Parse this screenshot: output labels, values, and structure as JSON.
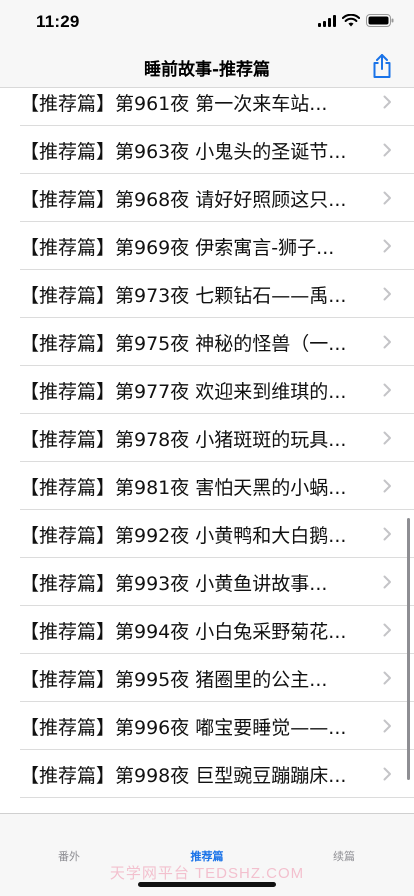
{
  "status_bar": {
    "time": "11:29"
  },
  "nav": {
    "title": "睡前故事-推荐篇"
  },
  "list": {
    "items": [
      {
        "label": "【推荐篇】第961夜 第一次来车站..."
      },
      {
        "label": "【推荐篇】第963夜 小鬼头的圣诞节..."
      },
      {
        "label": "【推荐篇】第968夜 请好好照顾这只..."
      },
      {
        "label": "【推荐篇】第969夜 伊索寓言-狮子..."
      },
      {
        "label": "【推荐篇】第973夜 七颗钻石——禹..."
      },
      {
        "label": "【推荐篇】第975夜 神秘的怪兽（一..."
      },
      {
        "label": "【推荐篇】第977夜 欢迎来到维琪的..."
      },
      {
        "label": "【推荐篇】第978夜 小猪斑斑的玩具..."
      },
      {
        "label": "【推荐篇】第981夜 害怕天黑的小蜗..."
      },
      {
        "label": "【推荐篇】第992夜 小黄鸭和大白鹅..."
      },
      {
        "label": "【推荐篇】第993夜 小黄鱼讲故事..."
      },
      {
        "label": "【推荐篇】第994夜 小白兔采野菊花..."
      },
      {
        "label": "【推荐篇】第995夜 猪圈里的公主..."
      },
      {
        "label": "【推荐篇】第996夜 嘟宝要睡觉——..."
      },
      {
        "label": "【推荐篇】第998夜 巨型豌豆蹦蹦床..."
      }
    ]
  },
  "tab_bar": {
    "tabs": [
      {
        "label": "番外",
        "active": false
      },
      {
        "label": "推荐篇",
        "active": true
      },
      {
        "label": "续篇",
        "active": false
      }
    ]
  },
  "watermark": "天学网平台  TEDSHZ.COM",
  "colors": {
    "accent": "#1a73e8",
    "inactive": "#8e8e93",
    "bar_bg": "#f7f7f7"
  },
  "icons": {
    "status": [
      "cellular-signal-icon",
      "wifi-icon",
      "battery-icon"
    ],
    "nav": "share-icon",
    "row": "chevron-right-icon"
  }
}
